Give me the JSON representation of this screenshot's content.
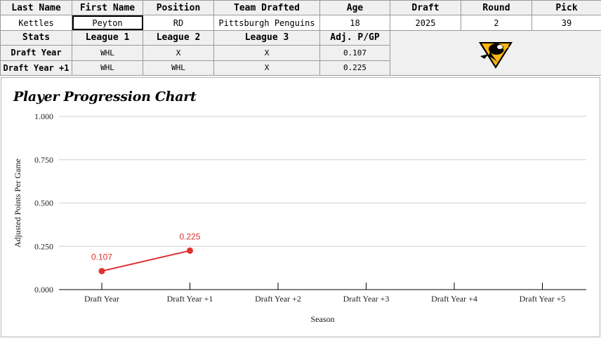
{
  "table": {
    "headers": [
      "Last Name",
      "First Name",
      "Position",
      "Team Drafted",
      "Age",
      "Draft",
      "Round",
      "Pick"
    ],
    "values": [
      "Kettles",
      "Peyton",
      "RD",
      "Pittsburgh Penguins",
      "18",
      "2025",
      "2",
      "39"
    ],
    "stats_headers": [
      "Stats",
      "League 1",
      "League 2",
      "League 3",
      "Adj. P/GP"
    ],
    "rows": [
      [
        "Draft Year",
        "WHL",
        "X",
        "X",
        "0.107"
      ],
      [
        "Draft Year +1",
        "WHL",
        "WHL",
        "X",
        "0.225"
      ]
    ],
    "logo_icon": "pittsburgh-penguins-logo"
  },
  "chart_data": {
    "type": "line",
    "title": "Player Progression Chart",
    "xlabel": "Season",
    "ylabel": "Adjusted Points Per Game",
    "categories": [
      "Draft Year",
      "Draft Year +1",
      "Draft Year +2",
      "Draft Year +3",
      "Draft Year +4",
      "Draft Year +5"
    ],
    "values": [
      0.107,
      0.225
    ],
    "data_labels": [
      "0.107",
      "0.225"
    ],
    "yticks": [
      "0.000",
      "0.250",
      "0.500",
      "0.750",
      "1.000"
    ],
    "ylim": [
      0,
      1
    ],
    "grid": true,
    "line_color": "#e03030"
  }
}
